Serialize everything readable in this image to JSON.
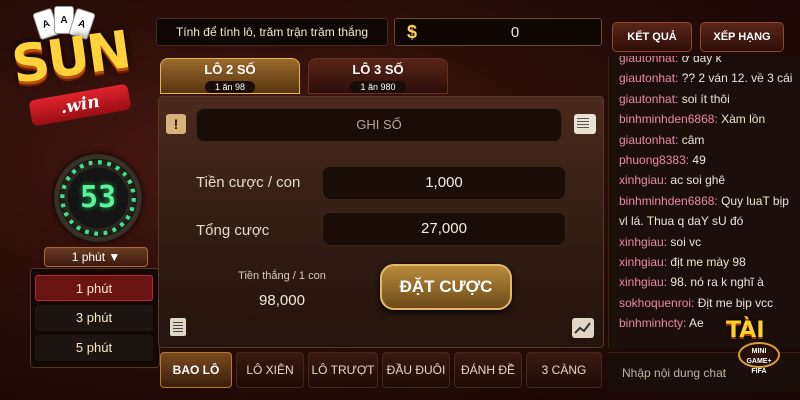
{
  "logo": {
    "brand": "SUN",
    "sub": ".win",
    "cards": [
      "A",
      "A",
      "A"
    ]
  },
  "timer": {
    "value": "53"
  },
  "period": {
    "selected_label": "1 phút ▼",
    "options": [
      "1 phút",
      "3 phút",
      "5 phút"
    ],
    "selected_index": 0
  },
  "header": {
    "title": "Tính để tính lô, trăm trận trăm thắng",
    "currency_symbol": "$",
    "balance": "0"
  },
  "top_buttons": {
    "results": "KẾT QUẢ",
    "ranking": "XẾP HẠNG"
  },
  "bet_tabs": [
    {
      "label": "LÔ 2 SỐ",
      "odds": "1 ăn 98",
      "active": true
    },
    {
      "label": "LÔ 3 SỐ",
      "odds": "1 ăn 980",
      "active": false
    }
  ],
  "form": {
    "note_placeholder": "GHI SỐ",
    "stake_label": "Tiền cược / con",
    "stake_value": "1,000",
    "total_label": "Tổng cược",
    "total_value": "27,000",
    "win_label": "Tiền thắng / 1 con",
    "win_value": "98,000",
    "bet_button": "ĐẶT CƯỢC"
  },
  "bottom_tabs": [
    {
      "label": "BAO LÔ",
      "active": true
    },
    {
      "label": "LÔ XIÊN",
      "active": false
    },
    {
      "label": "LÔ TRƯỢT",
      "active": false
    },
    {
      "label": "ĐẦU ĐUÔI",
      "active": false
    },
    {
      "label": "ĐÁNH ĐỀ",
      "active": false
    },
    {
      "label": "3 CÀNG",
      "active": false
    }
  ],
  "chat": {
    "messages": [
      {
        "user": "giautonhat:",
        "text": "ở đây k"
      },
      {
        "user": "giautonhat:",
        "text": "?? 2 ván 12. về 3 cái"
      },
      {
        "user": "giautonhat:",
        "text": "soi ít thôi"
      },
      {
        "user": "binhminhden6868:",
        "text": "Xàm lồn"
      },
      {
        "user": "giautonhat:",
        "text": "câm"
      },
      {
        "user": "phuong8383:",
        "text": "49"
      },
      {
        "user": "xinhgiau:",
        "text": "ac soi ghê"
      },
      {
        "user": "binhminhden6868:",
        "text": "Quy luaT bịp"
      },
      {
        "user": "",
        "text": "vl lá. Thua q daY sU đó"
      },
      {
        "user": "xinhgiau:",
        "text": "soi vc"
      },
      {
        "user": "xinhgiau:",
        "text": "địt me mày 98"
      },
      {
        "user": "xinhgiau:",
        "text": "98. nó ra k nghĩ à"
      },
      {
        "user": "sokhoquenroi:",
        "text": "Địt me bịp vcc"
      },
      {
        "user": "binhminhcty:",
        "text": "Ae"
      }
    ],
    "input_placeholder": "Nhập nội dung chat"
  },
  "tai_badge": {
    "title": "TÀI",
    "line1": "MINI",
    "line2": "GAME+",
    "line3": "FIFA"
  },
  "colors": {
    "accent_gold": "#e2b868",
    "timer_green": "#5af59a",
    "chat_username": "#e88aa8",
    "active_red": "#6a1414"
  }
}
